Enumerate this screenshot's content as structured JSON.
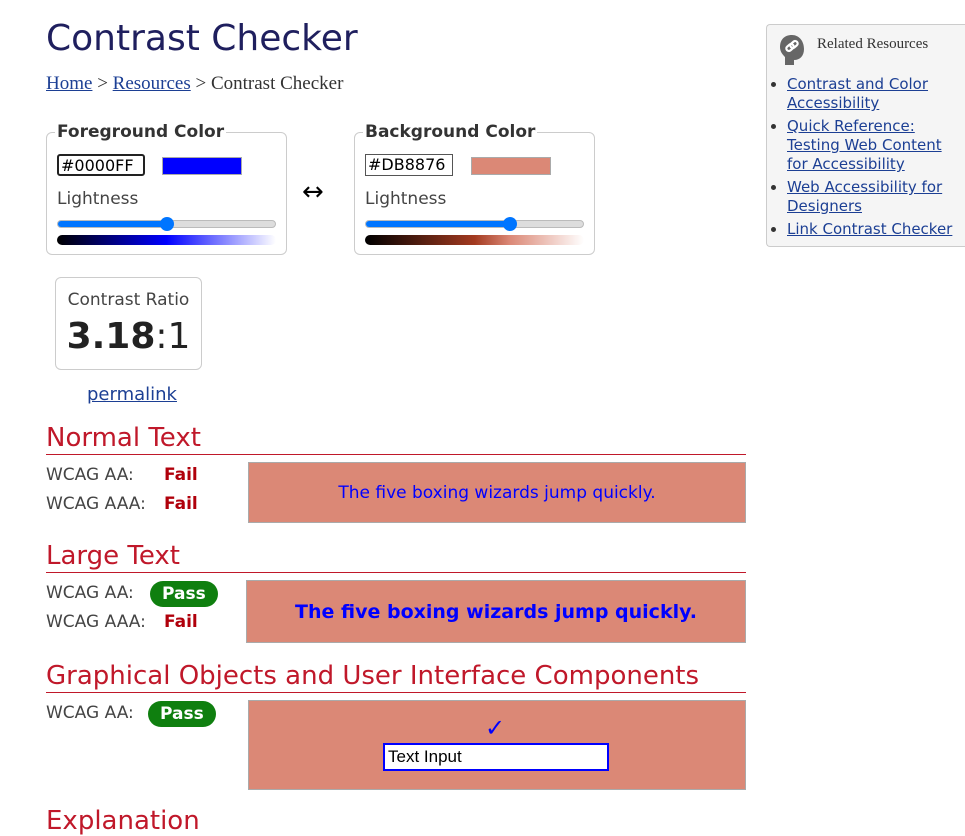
{
  "page": {
    "title": "Contrast Checker",
    "breadcrumb": {
      "home": "Home",
      "resources": "Resources",
      "sep": ">",
      "current": "Contrast Checker"
    }
  },
  "foreground": {
    "legend": "Foreground Color",
    "hex": "#0000FF",
    "swatch_color": "#0000FF",
    "lightness_label": "Lightness",
    "lightness_percent": 50
  },
  "background": {
    "legend": "Background Color",
    "hex": "#DB8876",
    "swatch_color": "#DB8876",
    "lightness_label": "Lightness",
    "lightness_percent": 66
  },
  "swap_icon": "↔",
  "ratio": {
    "label": "Contrast Ratio",
    "value": "3.18",
    "suffix": ":1"
  },
  "permalink": "permalink",
  "normal_text": {
    "heading": "Normal Text",
    "rows": [
      {
        "label": "WCAG AA:",
        "result": "Fail"
      },
      {
        "label": "WCAG AAA:",
        "result": "Fail"
      }
    ],
    "sample": "The five boxing wizards jump quickly."
  },
  "large_text": {
    "heading": "Large Text",
    "rows": [
      {
        "label": "WCAG AA:",
        "result": "Pass"
      },
      {
        "label": "WCAG AAA:",
        "result": "Fail"
      }
    ],
    "sample": "The five boxing wizards jump quickly."
  },
  "graphical": {
    "heading": "Graphical Objects and User Interface Components",
    "rows": [
      {
        "label": "WCAG AA:",
        "result": "Pass"
      }
    ],
    "check_icon": "✓",
    "input_value": "Text Input"
  },
  "explanation_heading": "Explanation",
  "sidebar": {
    "title": "Related Resources",
    "icon": "link-icon",
    "links": [
      "Contrast and Color Accessibility",
      "Quick Reference: Testing Web Content for Accessibility",
      "Web Accessibility for Designers",
      "Link Contrast Checker"
    ]
  },
  "colors": {
    "heading_red": "#c0182a",
    "fail_red": "#b0000b",
    "pass_green": "#0f7f0f",
    "link_blue": "#1c3f94",
    "slider_blue": "#0075ff"
  }
}
